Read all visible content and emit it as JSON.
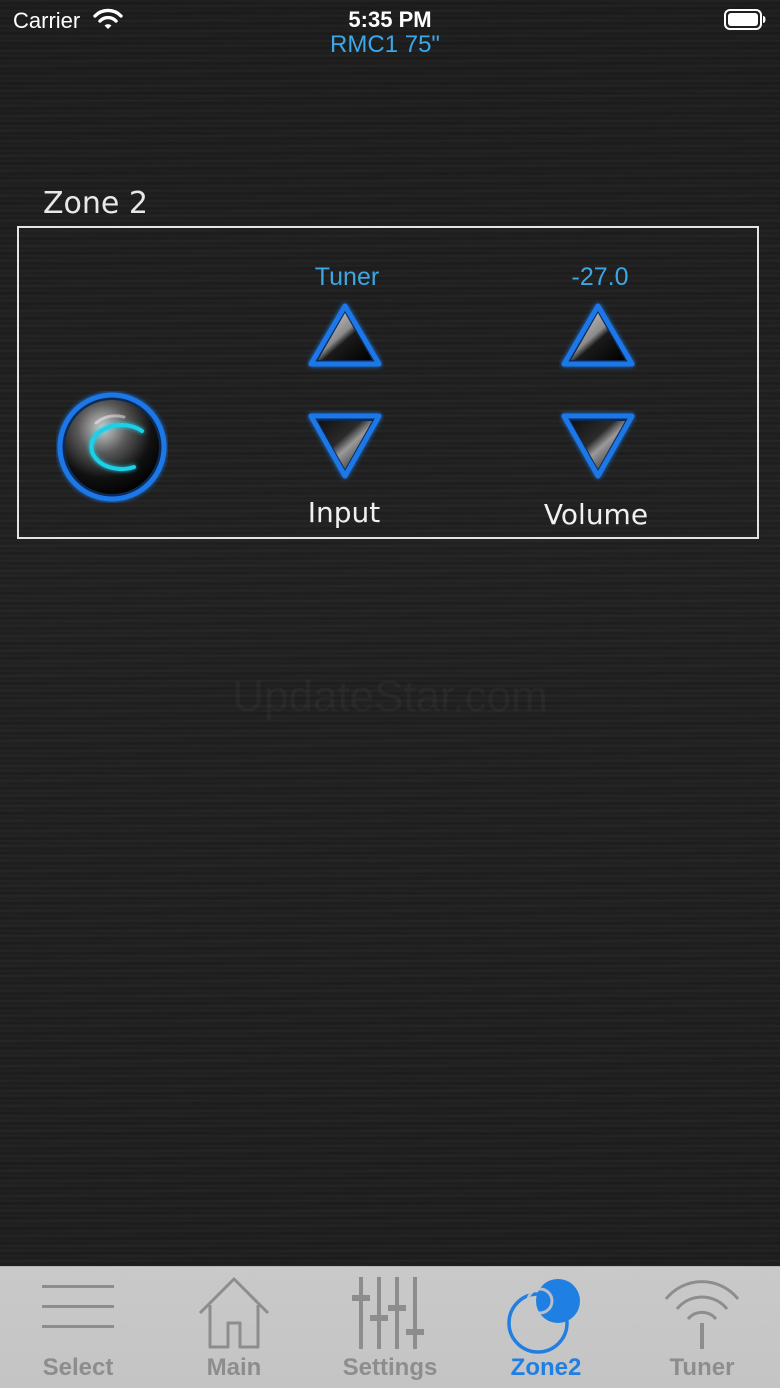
{
  "status_bar": {
    "carrier": "Carrier",
    "time": "5:35 PM",
    "wifi_icon": "wifi-icon",
    "battery_icon": "battery-icon"
  },
  "header": {
    "device_name": "RMC1 75\""
  },
  "zone": {
    "title": "Zone 2",
    "power_icon": "power-button-icon",
    "input": {
      "value": "Tuner",
      "label": "Input"
    },
    "volume": {
      "value": "-27.0",
      "label": "Volume"
    }
  },
  "watermark": "UpdateStar.com",
  "tab_bar": {
    "tabs": [
      {
        "label": "Select",
        "icon": "menu-lines-icon",
        "active": false
      },
      {
        "label": "Main",
        "icon": "home-icon",
        "active": false
      },
      {
        "label": "Settings",
        "icon": "sliders-icon",
        "active": false
      },
      {
        "label": "Zone2",
        "icon": "zone-circles-icon",
        "active": true
      },
      {
        "label": "Tuner",
        "icon": "radio-signal-icon",
        "active": false
      }
    ]
  },
  "colors": {
    "accent_blue": "#3ba7e6",
    "active_tab": "#1f7fe3",
    "inactive_tab": "#8d8d8d"
  }
}
